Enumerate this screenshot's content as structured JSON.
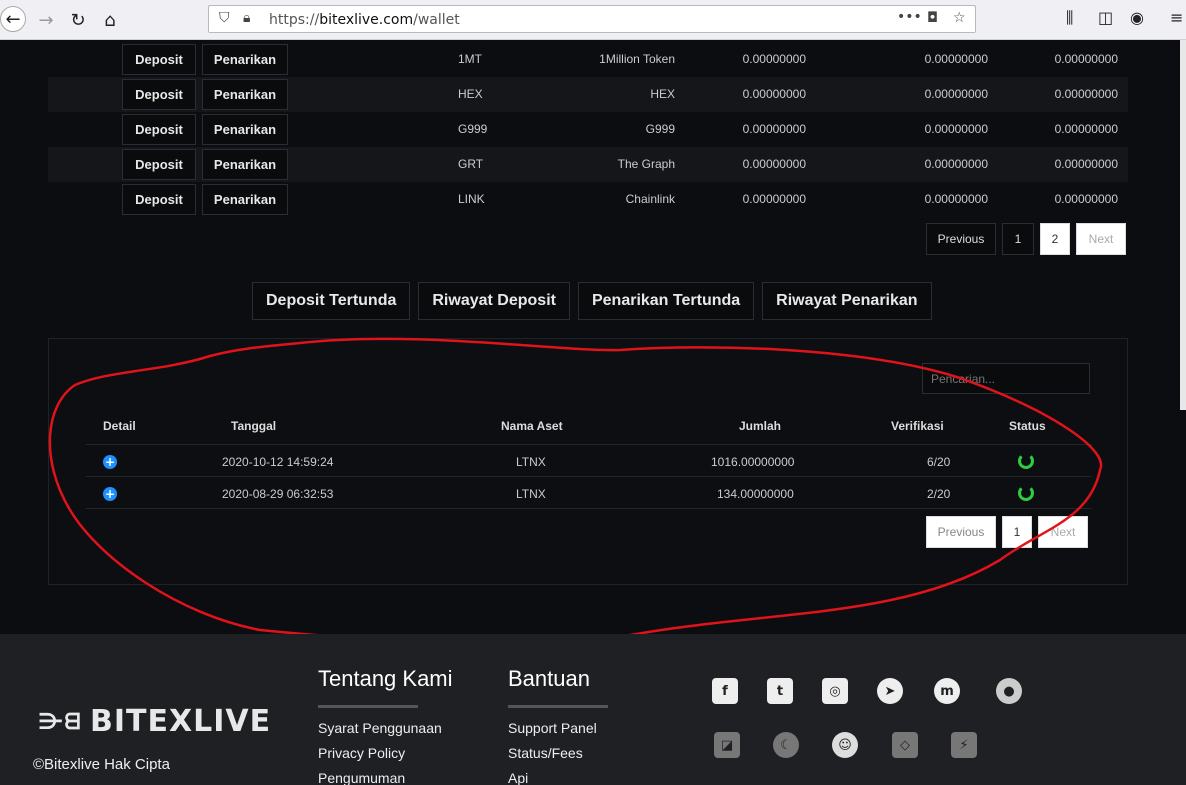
{
  "browser": {
    "url_scheme": "https://",
    "url_host": "bitexlive.com",
    "url_path": "/wallet"
  },
  "assets": {
    "deposit_label": "Deposit",
    "withdraw_label": "Penarikan",
    "rows": [
      {
        "symbol": "1MT",
        "name": "1Million Token",
        "available": "0.00000000",
        "pending": "0.00000000",
        "total": "0.00000000"
      },
      {
        "symbol": "HEX",
        "name": "HEX",
        "available": "0.00000000",
        "pending": "0.00000000",
        "total": "0.00000000"
      },
      {
        "symbol": "G999",
        "name": "G999",
        "available": "0.00000000",
        "pending": "0.00000000",
        "total": "0.00000000"
      },
      {
        "symbol": "GRT",
        "name": "The Graph",
        "available": "0.00000000",
        "pending": "0.00000000",
        "total": "0.00000000"
      },
      {
        "symbol": "LINK",
        "name": "Chainlink",
        "available": "0.00000000",
        "pending": "0.00000000",
        "total": "0.00000000"
      }
    ],
    "pager": {
      "previous": "Previous",
      "page1": "1",
      "page2": "2",
      "next": "Next"
    }
  },
  "tabs": [
    "Deposit Tertunda",
    "Riwayat Deposit",
    "Penarikan Tertunda",
    "Riwayat Penarikan"
  ],
  "history": {
    "search_placeholder": "Pencarian...",
    "headers": {
      "detail": "Detail",
      "date": "Tanggal",
      "asset": "Nama Aset",
      "amount": "Jumlah",
      "verification": "Verifikasi",
      "status": "Status"
    },
    "rows": [
      {
        "date": "2020-10-12 14:59:24",
        "asset": "LTNX",
        "amount": "1016.00000000",
        "verification": "6/20"
      },
      {
        "date": "2020-08-29 06:32:53",
        "asset": "LTNX",
        "amount": "134.00000000",
        "verification": "2/20"
      }
    ],
    "pager": {
      "previous": "Previous",
      "page1": "1",
      "next": "Next"
    }
  },
  "footer": {
    "logo": "BITEXLIVE",
    "copyright": "©Bitexlive Hak Cipta",
    "about": {
      "title": "Tentang Kami",
      "links": [
        "Syarat Penggunaan",
        "Privacy Policy",
        "Pengumuman"
      ]
    },
    "help": {
      "title": "Bantuan",
      "links": [
        "Support Panel",
        "Status/Fees",
        "Api"
      ]
    },
    "social_icons": [
      "facebook-icon",
      "twitter-icon",
      "instagram-icon",
      "telegram-icon",
      "coinmarketcap-icon",
      "coingecko-icon",
      "coinpaprika-icon",
      "coinhunt-icon",
      "nomics-icon",
      "coincodex-icon",
      "livecoinwatch-icon"
    ]
  },
  "colors": {
    "accent_blue": "#1e90ff",
    "status_green": "#2ecc40",
    "annotation_red": "#e0131b"
  }
}
